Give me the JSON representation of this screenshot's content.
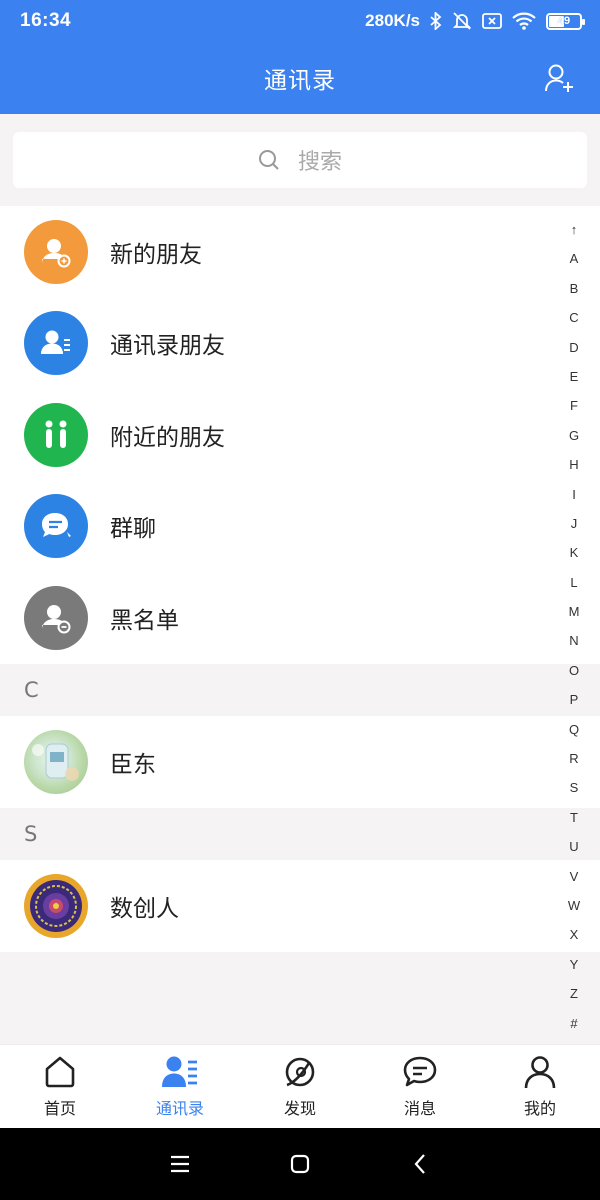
{
  "status_bar": {
    "time": "16:34",
    "network_speed": "280K/s",
    "battery": "49",
    "icons": [
      "bluetooth-icon",
      "mute-icon",
      "sim-off-icon",
      "wifi-icon",
      "battery-icon"
    ]
  },
  "header": {
    "title": "通讯录",
    "add_icon": "add-contact-icon"
  },
  "search": {
    "placeholder": "搜索",
    "icon": "search-icon"
  },
  "function_items": [
    {
      "label": "新的朋友",
      "icon": "new-friend-icon",
      "color": "#f39b3c"
    },
    {
      "label": "通讯录朋友",
      "icon": "contacts-friend-icon",
      "color": "#2c83e3"
    },
    {
      "label": "附近的朋友",
      "icon": "nearby-icon",
      "color": "#21b54f"
    },
    {
      "label": "群聊",
      "icon": "group-chat-icon",
      "color": "#2c83e3"
    },
    {
      "label": "黑名单",
      "icon": "blacklist-icon",
      "color": "#7a7a7a"
    }
  ],
  "sections": [
    {
      "letter": "C",
      "contacts": [
        {
          "name": "臣东",
          "avatar": "photo-avatar"
        }
      ]
    },
    {
      "letter": "S",
      "contacts": [
        {
          "name": "数创人",
          "avatar": "emblem-avatar"
        }
      ]
    }
  ],
  "alpha_index": [
    "↑",
    "A",
    "B",
    "C",
    "D",
    "E",
    "F",
    "G",
    "H",
    "I",
    "J",
    "K",
    "L",
    "M",
    "N",
    "O",
    "P",
    "Q",
    "R",
    "S",
    "T",
    "U",
    "V",
    "W",
    "X",
    "Y",
    "Z",
    "#"
  ],
  "bottom_nav": [
    {
      "label": "首页",
      "icon": "home-icon",
      "active": false
    },
    {
      "label": "通讯录",
      "icon": "contacts-icon",
      "active": true
    },
    {
      "label": "发现",
      "icon": "discover-icon",
      "active": false
    },
    {
      "label": "消息",
      "icon": "message-icon",
      "active": false
    },
    {
      "label": "我的",
      "icon": "profile-icon",
      "active": false
    }
  ],
  "system_nav": [
    "menu-icon",
    "home-square-icon",
    "back-icon"
  ],
  "colors": {
    "primary": "#3b82f0",
    "background": "#f5f3f4"
  }
}
